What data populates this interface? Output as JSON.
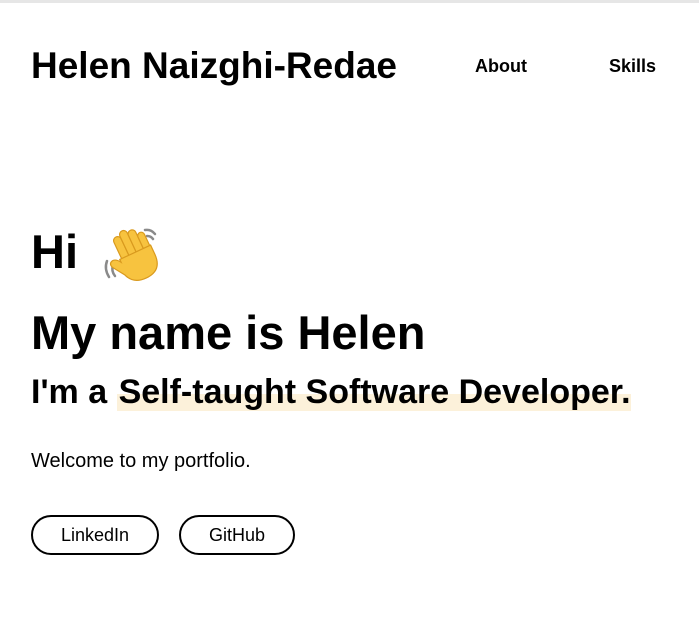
{
  "header": {
    "brand": "Helen Naizghi-Redae",
    "nav": {
      "about": "About",
      "skills": "Skills"
    }
  },
  "hero": {
    "greeting": "Hi",
    "greeting_icon": "waving-hand-icon",
    "name_line": "My name is Helen",
    "role_prefix": "I'm a ",
    "role_highlight": "Self-taught Software Developer.",
    "welcome": "Welcome to my portfolio.",
    "buttons": {
      "linkedin": "LinkedIn",
      "github": "GitHub"
    }
  },
  "colors": {
    "highlight": "#fcf1da",
    "text": "#000000",
    "background": "#ffffff"
  }
}
